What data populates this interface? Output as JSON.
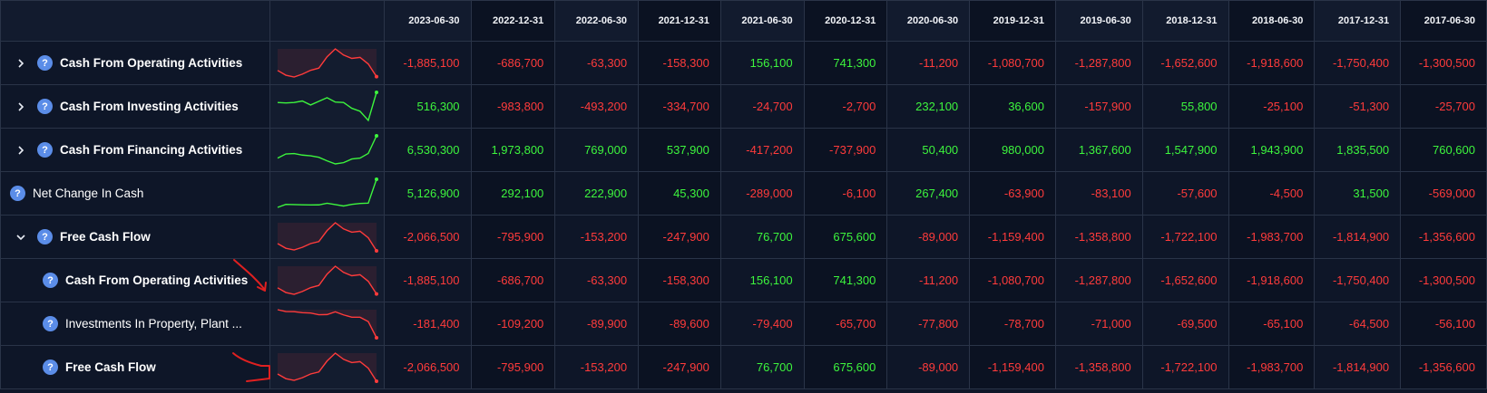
{
  "columns": [
    "2023-06-30",
    "2022-12-31",
    "2022-06-30",
    "2021-12-31",
    "2021-06-30",
    "2020-12-31",
    "2020-06-30",
    "2019-12-31",
    "2019-06-30",
    "2018-12-31",
    "2018-06-30",
    "2017-12-31",
    "2017-06-30"
  ],
  "colors": {
    "positive": "#3df53d",
    "negative": "#ff3b3b",
    "icon": "#5b8de8",
    "annotation": "#e02020"
  },
  "icons": {
    "expand": "chevron-right-icon",
    "collapse": "chevron-down-icon",
    "help": "question-mark-icon"
  },
  "help_glyph": "?",
  "rows": [
    {
      "label": "Cash From Operating Activities",
      "toggle": "expand",
      "indent": 0,
      "values": [
        "-1,885,100",
        "-686,700",
        "-63,300",
        "-158,300",
        "156,100",
        "741,300",
        "-11,200",
        "-1,080,700",
        "-1,287,800",
        "-1,652,600",
        "-1,918,600",
        "-1,750,400",
        "-1,300,500"
      ],
      "spark": [
        -1300500,
        -1750400,
        -1918600,
        -1652600,
        -1287800,
        -1080700,
        -11200,
        741300,
        156100,
        -158300,
        -63300,
        -686700,
        -1885100
      ],
      "spark_color": "negative"
    },
    {
      "label": "Cash From Investing Activities",
      "toggle": "expand",
      "indent": 0,
      "values": [
        "516,300",
        "-983,800",
        "-493,200",
        "-334,700",
        "-24,700",
        "-2,700",
        "232,100",
        "36,600",
        "-157,900",
        "55,800",
        "-25,100",
        "-51,300",
        "-25,700"
      ],
      "spark": [
        -25700,
        -51300,
        -25100,
        55800,
        -157900,
        36600,
        232100,
        -2700,
        -24700,
        -334700,
        -493200,
        -983800,
        516300
      ],
      "spark_color": "positive"
    },
    {
      "label": "Cash From Financing Activities",
      "toggle": "expand",
      "indent": 0,
      "values": [
        "6,530,300",
        "1,973,800",
        "769,000",
        "537,900",
        "-417,200",
        "-737,900",
        "50,400",
        "980,000",
        "1,367,600",
        "1,547,900",
        "1,943,900",
        "1,835,500",
        "760,600"
      ],
      "spark": [
        760600,
        1835500,
        1943900,
        1547900,
        1367600,
        980000,
        50400,
        -737900,
        -417200,
        537900,
        769000,
        1973800,
        6530300
      ],
      "spark_color": "positive"
    },
    {
      "label": "Net Change In Cash",
      "toggle": "none",
      "indent": 0,
      "normal": true,
      "values": [
        "5,126,900",
        "292,100",
        "222,900",
        "45,300",
        "-289,000",
        "-6,100",
        "267,400",
        "-63,900",
        "-83,100",
        "-57,600",
        "-4,500",
        "31,500",
        "-569,000"
      ],
      "spark": [
        -569000,
        31500,
        -4500,
        -57600,
        -83100,
        -63900,
        267400,
        -6100,
        -289000,
        45300,
        222900,
        292100,
        5126900
      ],
      "spark_color": "positive"
    },
    {
      "label": "Free Cash Flow",
      "toggle": "collapse",
      "indent": 0,
      "values": [
        "-2,066,500",
        "-795,900",
        "-153,200",
        "-247,900",
        "76,700",
        "675,600",
        "-89,000",
        "-1,159,400",
        "-1,358,800",
        "-1,722,100",
        "-1,983,700",
        "-1,814,900",
        "-1,356,600"
      ],
      "spark": [
        -1356600,
        -1814900,
        -1983700,
        -1722100,
        -1358800,
        -1159400,
        -89000,
        675600,
        76700,
        -247900,
        -153200,
        -795900,
        -2066500
      ],
      "spark_color": "negative"
    },
    {
      "label": "Cash From Operating Activities",
      "toggle": "none",
      "indent": 1,
      "values": [
        "-1,885,100",
        "-686,700",
        "-63,300",
        "-158,300",
        "156,100",
        "741,300",
        "-11,200",
        "-1,080,700",
        "-1,287,800",
        "-1,652,600",
        "-1,918,600",
        "-1,750,400",
        "-1,300,500"
      ],
      "spark": [
        -1300500,
        -1750400,
        -1918600,
        -1652600,
        -1287800,
        -1080700,
        -11200,
        741300,
        156100,
        -158300,
        -63300,
        -686700,
        -1885100
      ],
      "spark_color": "negative"
    },
    {
      "label": "Investments In Property, Plant ...",
      "toggle": "none",
      "indent": 1,
      "normal": true,
      "values": [
        "-181,400",
        "-109,200",
        "-89,900",
        "-89,600",
        "-79,400",
        "-65,700",
        "-77,800",
        "-78,700",
        "-71,000",
        "-69,500",
        "-65,100",
        "-64,500",
        "-56,100"
      ],
      "spark": [
        -56100,
        -64500,
        -65100,
        -69500,
        -71000,
        -78700,
        -77800,
        -65700,
        -79400,
        -89600,
        -89900,
        -109200,
        -181400
      ],
      "spark_color": "negative"
    },
    {
      "label": "Free Cash Flow",
      "toggle": "none",
      "indent": 1,
      "values": [
        "-2,066,500",
        "-795,900",
        "-153,200",
        "-247,900",
        "76,700",
        "675,600",
        "-89,000",
        "-1,159,400",
        "-1,358,800",
        "-1,722,100",
        "-1,983,700",
        "-1,814,900",
        "-1,356,600"
      ],
      "spark": [
        -1356600,
        -1814900,
        -1983700,
        -1722100,
        -1358800,
        -1159400,
        -89000,
        675600,
        76700,
        -247900,
        -153200,
        -795900,
        -2066500
      ],
      "spark_color": "negative"
    }
  ]
}
